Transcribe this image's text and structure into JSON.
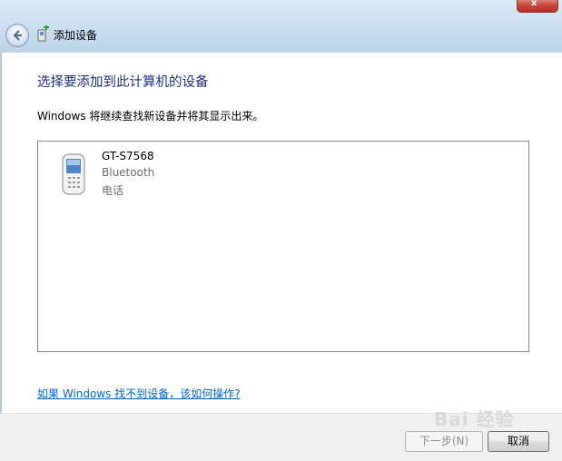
{
  "window": {
    "title": "添加设备",
    "close_glyph": "x"
  },
  "main": {
    "heading": "选择要添加到此计算机的设备",
    "info": "Windows 将继续查找新设备并将其显示出来。",
    "devices": [
      {
        "name": "GT-S7568",
        "connection": "Bluetooth",
        "category": "电话",
        "icon": "mobile-phone-icon"
      }
    ],
    "help_link": "如果 Windows 找不到设备，该如何操作?"
  },
  "footer": {
    "next_label": "下一步(N)",
    "cancel_label": "取消"
  },
  "watermark": "Bai 经验",
  "colors": {
    "heading": "#1e3287",
    "link": "#0066cc",
    "titlebar": "#c8ddf0"
  }
}
